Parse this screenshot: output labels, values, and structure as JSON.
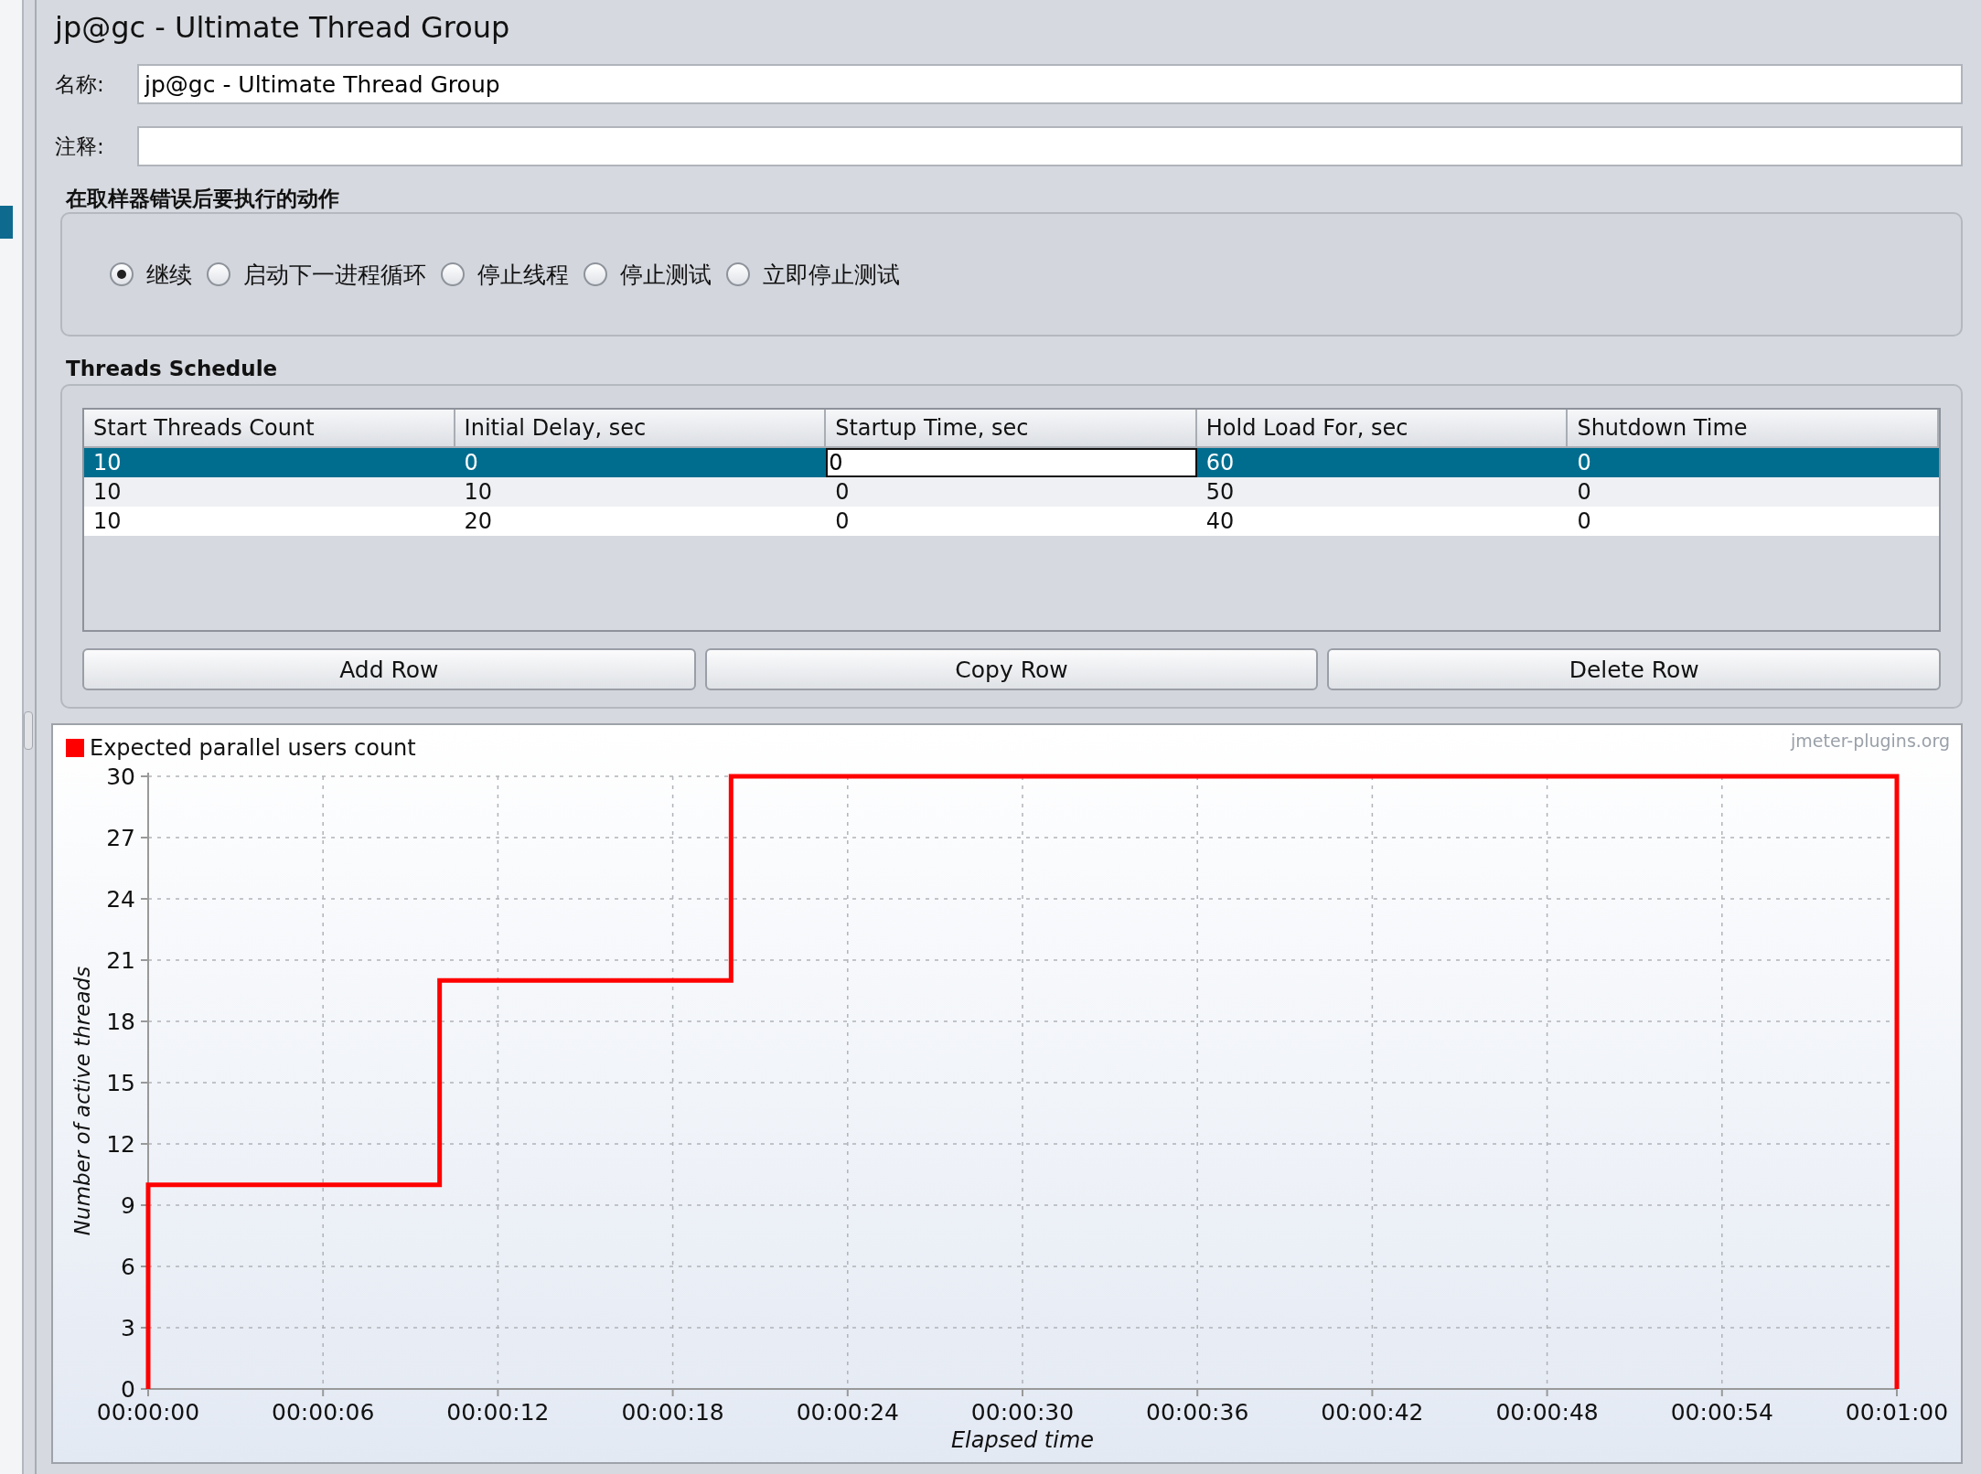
{
  "window": {
    "title": "jp@gc - Ultimate Thread Group"
  },
  "name_field": {
    "label": "名称:",
    "value": "jp@gc - Ultimate Thread Group"
  },
  "comment_field": {
    "label": "注释:"
  },
  "sampler_error_action": {
    "title": "在取样器错误后要执行的动作",
    "options": [
      {
        "label": "继续",
        "selected": true
      },
      {
        "label": "启动下一进程循环",
        "selected": false
      },
      {
        "label": "停止线程",
        "selected": false
      },
      {
        "label": "停止测试",
        "selected": false
      },
      {
        "label": "立即停止测试",
        "selected": false
      }
    ]
  },
  "threads_schedule": {
    "title": "Threads Schedule",
    "columns": [
      "Start Threads Count",
      "Initial Delay, sec",
      "Startup Time, sec",
      "Hold Load For, sec",
      "Shutdown Time"
    ],
    "rows": [
      {
        "selected": true,
        "cells": [
          {
            "value": "10",
            "editing": false
          },
          {
            "value": "0",
            "editing": false
          },
          {
            "value": "0",
            "editing": true
          },
          {
            "value": "60",
            "editing": false
          },
          {
            "value": "0",
            "editing": false
          }
        ]
      },
      {
        "selected": false,
        "cells": [
          {
            "value": "10",
            "editing": false
          },
          {
            "value": "10",
            "editing": false
          },
          {
            "value": "0",
            "editing": false
          },
          {
            "value": "50",
            "editing": false
          },
          {
            "value": "0",
            "editing": false
          }
        ]
      },
      {
        "selected": false,
        "cells": [
          {
            "value": "10",
            "editing": false
          },
          {
            "value": "20",
            "editing": false
          },
          {
            "value": "0",
            "editing": false
          },
          {
            "value": "40",
            "editing": false
          },
          {
            "value": "0",
            "editing": false
          }
        ]
      }
    ],
    "buttons": [
      "Add Row",
      "Copy Row",
      "Delete Row"
    ]
  },
  "chart": {
    "credit": "jmeter-plugins.org",
    "chart_data": {
      "type": "line",
      "xlabel": "Elapsed time",
      "ylabel": "Number of active threads",
      "x": [
        0,
        0,
        10,
        10,
        20,
        20,
        60,
        60
      ],
      "series": [
        {
          "name": "Expected parallel users count",
          "color": "#ff0000",
          "values": [
            0,
            10,
            10,
            20,
            20,
            30,
            30,
            0
          ]
        }
      ],
      "xlim": [
        0,
        60
      ],
      "ylim": [
        0,
        30
      ],
      "xticks": [
        {
          "value": 0,
          "label": "00:00:00"
        },
        {
          "value": 6,
          "label": "00:00:06"
        },
        {
          "value": 12,
          "label": "00:00:12"
        },
        {
          "value": 18,
          "label": "00:00:18"
        },
        {
          "value": 24,
          "label": "00:00:24"
        },
        {
          "value": 30,
          "label": "00:00:30"
        },
        {
          "value": 36,
          "label": "00:00:36"
        },
        {
          "value": 42,
          "label": "00:00:42"
        },
        {
          "value": 48,
          "label": "00:00:48"
        },
        {
          "value": 54,
          "label": "00:00:54"
        },
        {
          "value": 60,
          "label": "00:01:00"
        }
      ],
      "yticks": [
        0,
        3,
        6,
        9,
        12,
        15,
        18,
        21,
        24,
        27,
        30
      ],
      "grid": true
    }
  }
}
